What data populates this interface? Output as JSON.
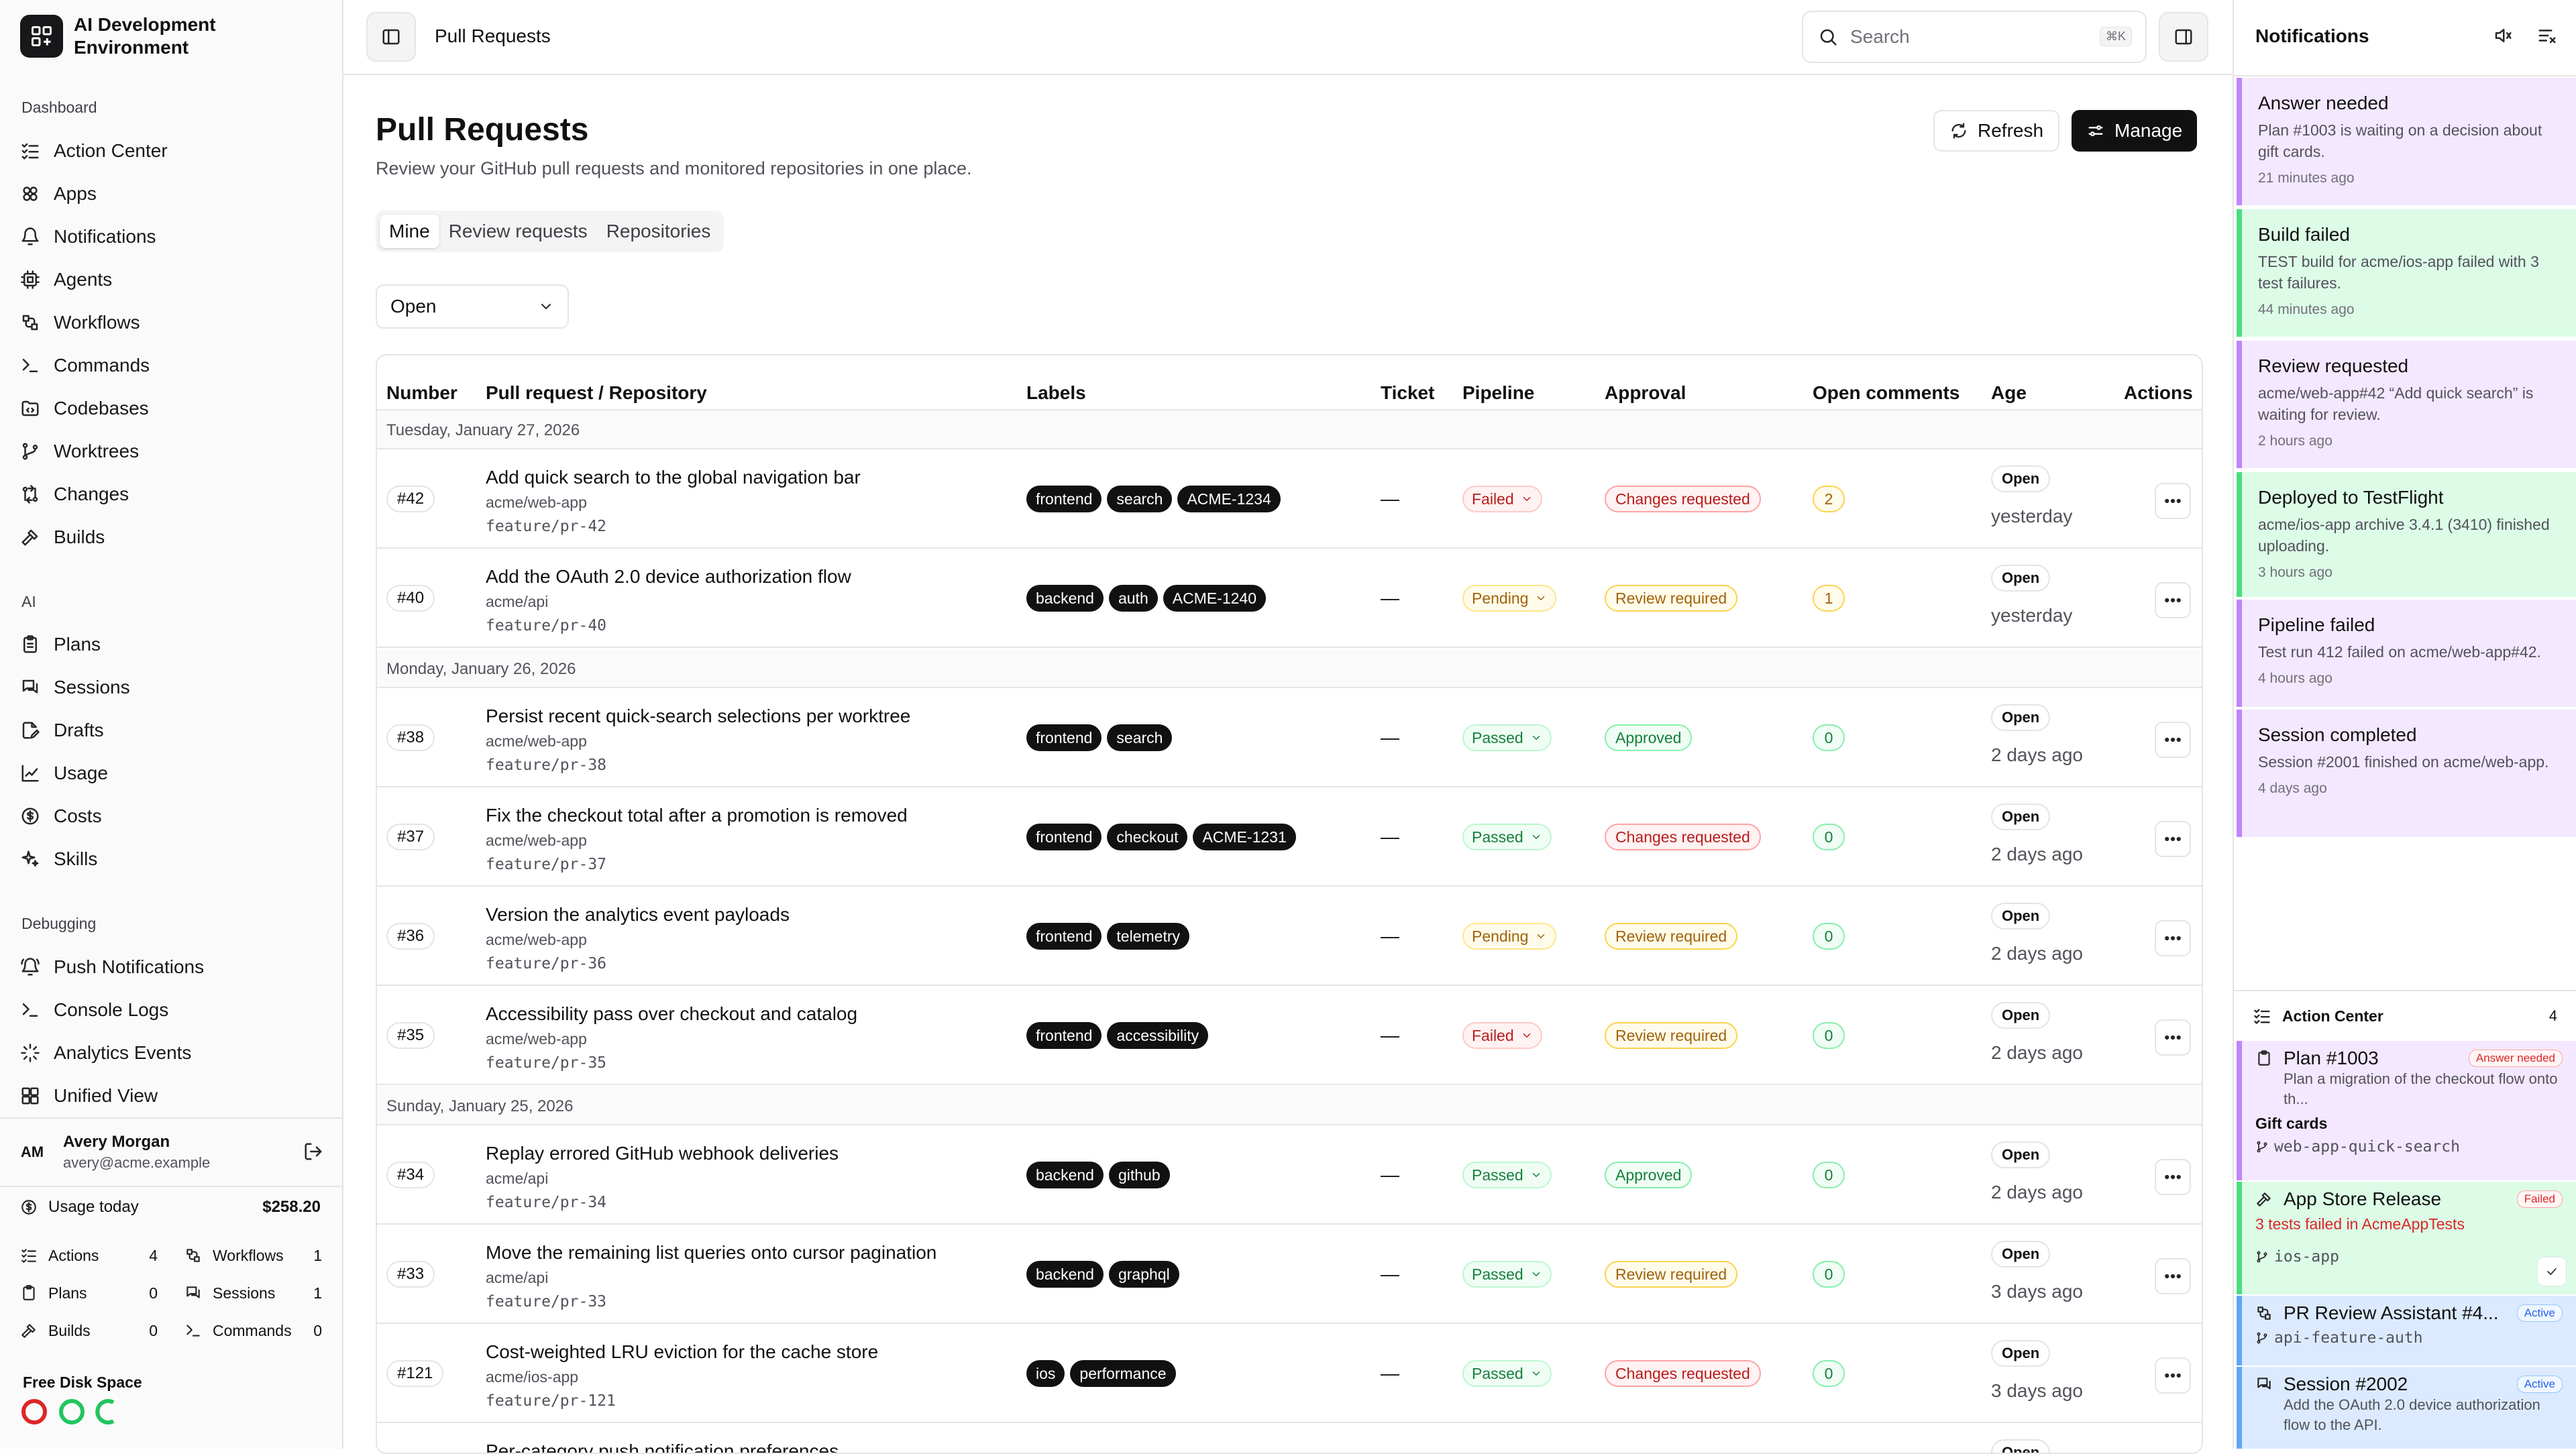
{
  "app": {
    "name": "AI Development Environment"
  },
  "sidebar": {
    "sections": [
      {
        "label": "Dashboard",
        "items": [
          {
            "label": "Action Center",
            "icon": "list-checks-icon"
          },
          {
            "label": "Apps",
            "icon": "apps-icon"
          },
          {
            "label": "Notifications",
            "icon": "bell-icon"
          },
          {
            "label": "Agents",
            "icon": "cpu-icon"
          },
          {
            "label": "Workflows",
            "icon": "workflow-icon"
          },
          {
            "label": "Commands",
            "icon": "terminal-icon"
          },
          {
            "label": "Codebases",
            "icon": "folder-code-icon"
          },
          {
            "label": "Worktrees",
            "icon": "git-branch-icon"
          },
          {
            "label": "Changes",
            "icon": "git-compare-icon"
          },
          {
            "label": "Builds",
            "icon": "hammer-icon"
          }
        ]
      },
      {
        "label": "AI",
        "items": [
          {
            "label": "Plans",
            "icon": "clipboard-icon"
          },
          {
            "label": "Sessions",
            "icon": "messages-icon"
          },
          {
            "label": "Drafts",
            "icon": "file-edit-icon"
          },
          {
            "label": "Usage",
            "icon": "chart-line-icon"
          },
          {
            "label": "Costs",
            "icon": "dollar-circle-icon"
          },
          {
            "label": "Skills",
            "icon": "sparkles-icon"
          }
        ]
      },
      {
        "label": "Debugging",
        "items": [
          {
            "label": "Push Notifications",
            "icon": "bell-ring-icon"
          },
          {
            "label": "Console Logs",
            "icon": "terminal-icon"
          },
          {
            "label": "Analytics Events",
            "icon": "activity-icon"
          },
          {
            "label": "Unified View",
            "icon": "layout-grid-icon"
          }
        ]
      }
    ],
    "user": {
      "initials": "AM",
      "name": "Avery Morgan",
      "email": "avery@acme.example"
    },
    "usage": {
      "label": "Usage today",
      "value": "$258.20"
    },
    "stats": [
      {
        "label": "Actions",
        "value": "4"
      },
      {
        "label": "Workflows",
        "value": "1"
      },
      {
        "label": "Plans",
        "value": "0"
      },
      {
        "label": "Sessions",
        "value": "1"
      },
      {
        "label": "Builds",
        "value": "0"
      },
      {
        "label": "Commands",
        "value": "0"
      }
    ],
    "disk": {
      "label": "Free Disk Space",
      "colors": [
        "#dc2626",
        "#22c55e",
        "#22c55e"
      ]
    }
  },
  "topbar": {
    "breadcrumb": "Pull Requests",
    "search_placeholder": "Search",
    "search_shortcut": "⌘K"
  },
  "page": {
    "title": "Pull Requests",
    "subtitle": "Review your GitHub pull requests and monitored repositories in one place.",
    "refresh_label": "Refresh",
    "manage_label": "Manage",
    "tabs": [
      "Mine",
      "Review requests",
      "Repositories"
    ],
    "active_tab": "Mine",
    "filter": "Open"
  },
  "table": {
    "columns": [
      "Number",
      "Pull request / Repository",
      "Labels",
      "Ticket",
      "Pipeline",
      "Approval",
      "Open comments",
      "Age",
      "Actions"
    ],
    "groups": [
      {
        "date": "Tuesday, January 27, 2026",
        "rows": [
          {
            "number": "#42",
            "title": "Add quick search to the global navigation bar",
            "repo": "acme/web-app",
            "branch": "feature/pr-42",
            "labels": [
              "frontend",
              "search",
              "ACME-1234"
            ],
            "ticket": "—",
            "pipeline": "Failed",
            "approval": "Changes requested",
            "comments": "2",
            "state": "Open",
            "age": "yesterday"
          },
          {
            "number": "#40",
            "title": "Add the OAuth 2.0 device authorization flow",
            "repo": "acme/api",
            "branch": "feature/pr-40",
            "labels": [
              "backend",
              "auth",
              "ACME-1240"
            ],
            "ticket": "—",
            "pipeline": "Pending",
            "approval": "Review required",
            "comments": "1",
            "state": "Open",
            "age": "yesterday"
          }
        ]
      },
      {
        "date": "Monday, January 26, 2026",
        "rows": [
          {
            "number": "#38",
            "title": "Persist recent quick-search selections per worktree",
            "repo": "acme/web-app",
            "branch": "feature/pr-38",
            "labels": [
              "frontend",
              "search"
            ],
            "ticket": "—",
            "pipeline": "Passed",
            "approval": "Approved",
            "comments": "0",
            "state": "Open",
            "age": "2 days ago"
          },
          {
            "number": "#37",
            "title": "Fix the checkout total after a promotion is removed",
            "repo": "acme/web-app",
            "branch": "feature/pr-37",
            "labels": [
              "frontend",
              "checkout",
              "ACME-1231"
            ],
            "ticket": "—",
            "pipeline": "Passed",
            "approval": "Changes requested",
            "comments": "0",
            "state": "Open",
            "age": "2 days ago"
          },
          {
            "number": "#36",
            "title": "Version the analytics event payloads",
            "repo": "acme/web-app",
            "branch": "feature/pr-36",
            "labels": [
              "frontend",
              "telemetry"
            ],
            "ticket": "—",
            "pipeline": "Pending",
            "approval": "Review required",
            "comments": "0",
            "state": "Open",
            "age": "2 days ago"
          },
          {
            "number": "#35",
            "title": "Accessibility pass over checkout and catalog",
            "repo": "acme/web-app",
            "branch": "feature/pr-35",
            "labels": [
              "frontend",
              "accessibility"
            ],
            "ticket": "—",
            "pipeline": "Failed",
            "approval": "Review required",
            "comments": "0",
            "state": "Open",
            "age": "2 days ago"
          }
        ]
      },
      {
        "date": "Sunday, January 25, 2026",
        "rows": [
          {
            "number": "#34",
            "title": "Replay errored GitHub webhook deliveries",
            "repo": "acme/api",
            "branch": "feature/pr-34",
            "labels": [
              "backend",
              "github"
            ],
            "ticket": "—",
            "pipeline": "Passed",
            "approval": "Approved",
            "comments": "0",
            "state": "Open",
            "age": "2 days ago"
          },
          {
            "number": "#33",
            "title": "Move the remaining list queries onto cursor pagination",
            "repo": "acme/api",
            "branch": "feature/pr-33",
            "labels": [
              "backend",
              "graphql"
            ],
            "ticket": "—",
            "pipeline": "Passed",
            "approval": "Review required",
            "comments": "0",
            "state": "Open",
            "age": "3 days ago"
          },
          {
            "number": "#121",
            "title": "Cost-weighted LRU eviction for the cache store",
            "repo": "acme/ios-app",
            "branch": "feature/pr-121",
            "labels": [
              "ios",
              "performance"
            ],
            "ticket": "—",
            "pipeline": "Passed",
            "approval": "Changes requested",
            "comments": "0",
            "state": "Open",
            "age": "3 days ago"
          },
          {
            "number": "",
            "title": "Per-category push notification preferences",
            "repo": "",
            "branch": "",
            "labels": [],
            "ticket": "",
            "pipeline": "",
            "approval": "",
            "comments": "",
            "state": "Open",
            "age": ""
          }
        ]
      }
    ]
  },
  "notifications": {
    "title": "Notifications",
    "items": [
      {
        "title": "Answer needed",
        "body": "Plan #1003 is waiting on a decision about gift cards.",
        "time": "21 minutes ago",
        "color": "purple"
      },
      {
        "title": "Build failed",
        "body": "TEST build for acme/ios-app failed with 3 test failures.",
        "time": "44 minutes ago",
        "color": "green"
      },
      {
        "title": "Review requested",
        "body": "acme/web-app#42 “Add quick search” is waiting for review.",
        "time": "2 hours ago",
        "color": "purple"
      },
      {
        "title": "Deployed to TestFlight",
        "body": "acme/ios-app archive 3.4.1 (3410) finished uploading.",
        "time": "3 hours ago",
        "color": "green"
      },
      {
        "title": "Pipeline failed",
        "body": "Test run 412 failed on acme/web-app#42.",
        "time": "4 hours ago",
        "color": "purple"
      },
      {
        "title": "Session completed",
        "body": "Session #2001 finished on acme/web-app.",
        "time": "4 days ago",
        "color": "purple"
      }
    ]
  },
  "action_center": {
    "title": "Action Center",
    "count": "4",
    "items": [
      {
        "name": "Plan #1003",
        "badge": "Answer needed",
        "desc": "Plan a migration of the checkout flow onto th...",
        "extra": "Gift cards",
        "branch": "web-app-quick-search"
      },
      {
        "name": "App Store Release",
        "badge": "Failed",
        "desc": "3 tests failed in AcmeAppTests",
        "branch": "ios-app"
      },
      {
        "name": "PR Review Assistant #4...",
        "badge": "Active",
        "branch": "api-feature-auth"
      },
      {
        "name": "Session #2002",
        "badge": "Active",
        "desc": "Add the OAuth 2.0 device authorization flow to the API."
      }
    ]
  }
}
